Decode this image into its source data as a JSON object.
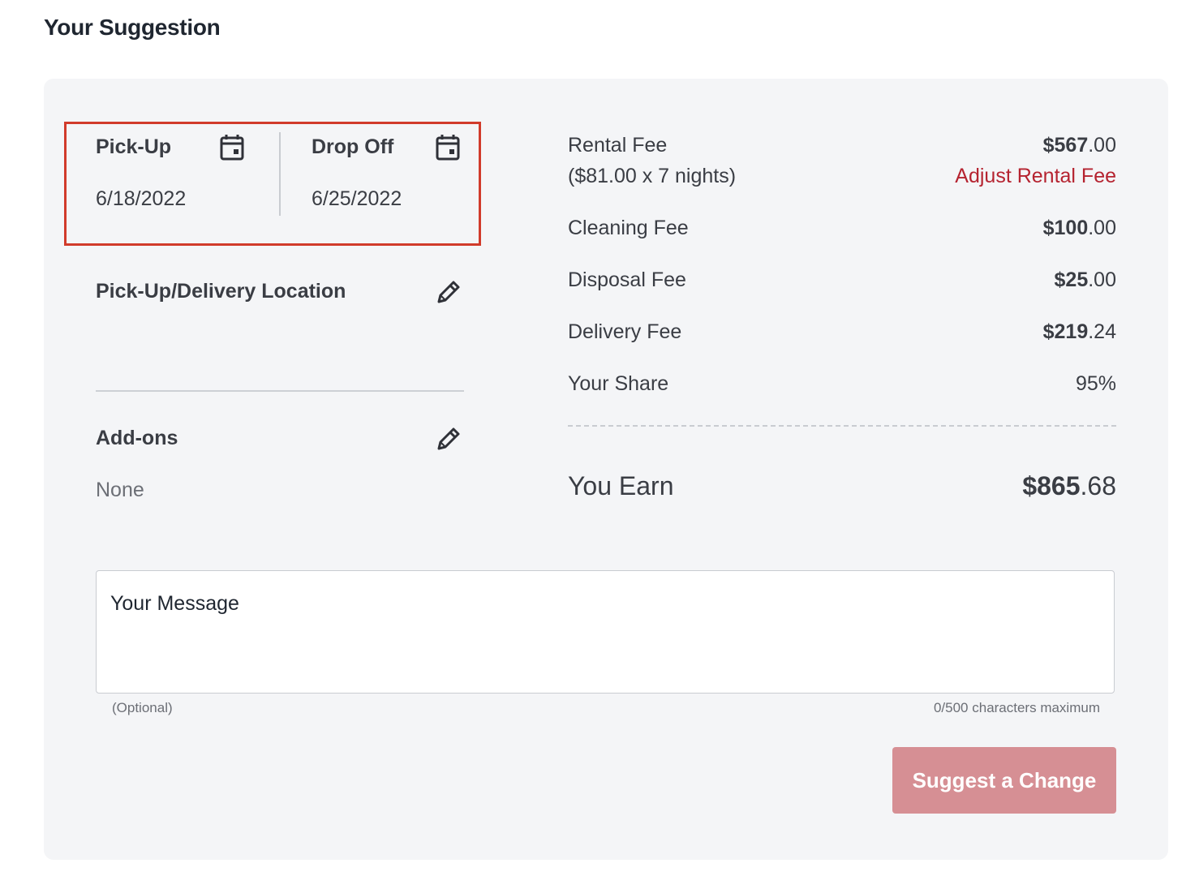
{
  "page": {
    "title": "Your Suggestion"
  },
  "dates": {
    "pickup": {
      "label": "Pick-Up",
      "value": "6/18/2022",
      "icon": "calendar-icon"
    },
    "dropoff": {
      "label": "Drop Off",
      "value": "6/25/2022",
      "icon": "calendar-icon"
    }
  },
  "location": {
    "label": "Pick-Up/Delivery Location",
    "icon": "pencil-icon"
  },
  "addons": {
    "label": "Add-ons",
    "value": "None",
    "icon": "pencil-icon"
  },
  "fees": {
    "rental": {
      "label": "Rental Fee",
      "sublabel": "($81.00 x 7 nights)",
      "whole": "$567",
      "cents": ".00",
      "adjust_label": "Adjust Rental Fee"
    },
    "cleaning": {
      "label": "Cleaning Fee",
      "whole": "$100",
      "cents": ".00"
    },
    "disposal": {
      "label": "Disposal Fee",
      "whole": "$25",
      "cents": ".00"
    },
    "delivery": {
      "label": "Delivery Fee",
      "whole": "$219",
      "cents": ".24"
    },
    "share": {
      "label": "Your Share",
      "value": "95%"
    }
  },
  "earn": {
    "label": "You Earn",
    "whole": "$865",
    "cents": ".68"
  },
  "message": {
    "placeholder": "Your Message",
    "value": "",
    "hint_left": "(Optional)",
    "hint_right": "0/500 characters maximum"
  },
  "actions": {
    "suggest_label": "Suggest a Change"
  },
  "colors": {
    "highlight_border": "#d13b2b",
    "link": "#b52330",
    "button_bg": "#d68f94",
    "card_bg": "#f4f5f7"
  }
}
